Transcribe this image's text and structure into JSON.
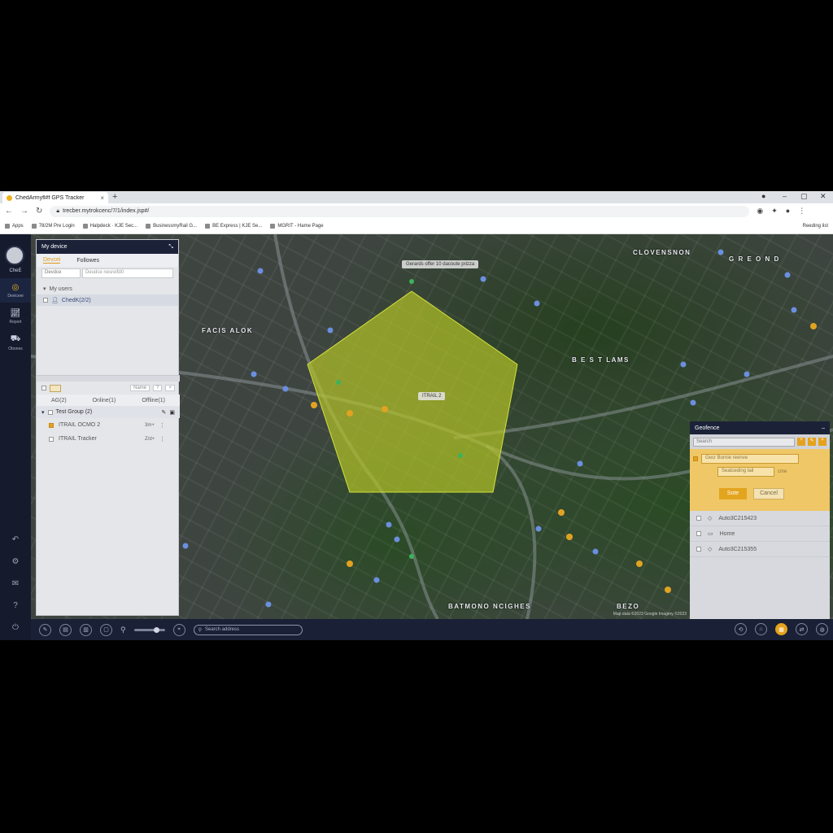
{
  "browser": {
    "tab_title": "ChedArmyfl#f GPS Tracker",
    "tab_close": "×",
    "new_tab": "+",
    "url": "trecber.mytrokcenc/7/1/index.jsp#/",
    "bookmarks": [
      "Apps",
      "78/2M Pre Login",
      "Halpdeck · KJE Sec...",
      "BusinessmyRail G...",
      "BE Express | KJE Se...",
      "MGRIT - Hame Page"
    ],
    "reading_list": "Reeding list"
  },
  "leftnav": {
    "user_name": "CheE",
    "items": [
      {
        "label": "Deviceei",
        "icon": "satellite-icon"
      },
      {
        "label": "Report",
        "icon": "report-icon"
      },
      {
        "label": "Obones",
        "icon": "car-icon"
      }
    ]
  },
  "device_panel": {
    "title": "My device",
    "tabs": [
      "Devcei",
      "Followes"
    ],
    "search_type": "Devdce",
    "search_placeholder": "Deudce nesreifd0",
    "tree_header": "My users",
    "user_node": "ChedK(2/2)",
    "name_select": "Name",
    "stats": {
      "all": "AG(2)",
      "online": "Online(1)",
      "offline": "Offline(1)"
    },
    "group": "Test Group (2)",
    "devices": [
      {
        "name": "ITRAIL OCMO 2",
        "status": "3m+",
        "checked": true
      },
      {
        "name": "ITRAIL Tracker",
        "status": "Z/d+",
        "checked": false
      }
    ]
  },
  "map": {
    "labels": [
      "CLOVENSNON",
      "G R E O N D",
      "FACIS ALOK",
      "B E S T LAMS",
      "BATMONO NCIGHES",
      "BEZO"
    ],
    "note_top": "Gerards offer 10 dacoute prizza",
    "device_tag": "ITRAIL 2",
    "attribution": "Map data ©2023 Google Imagery ©2023"
  },
  "geofence": {
    "title": "Geofence",
    "search_placeholder": "Search",
    "name_placeholder": "Gecr Bornie reenve",
    "type_placeholder": "Seatceding tail",
    "type_hint": "cme",
    "save": "Sote",
    "cancel": "Cancel",
    "items": [
      "Auto3C215423",
      "Home",
      "Auto3C215355"
    ]
  },
  "toolbar": {
    "search_placeholder": "Search address"
  },
  "colors": {
    "accent": "#e5a21d",
    "geofence_fill": "#b7c726",
    "navy": "#1b2238"
  }
}
